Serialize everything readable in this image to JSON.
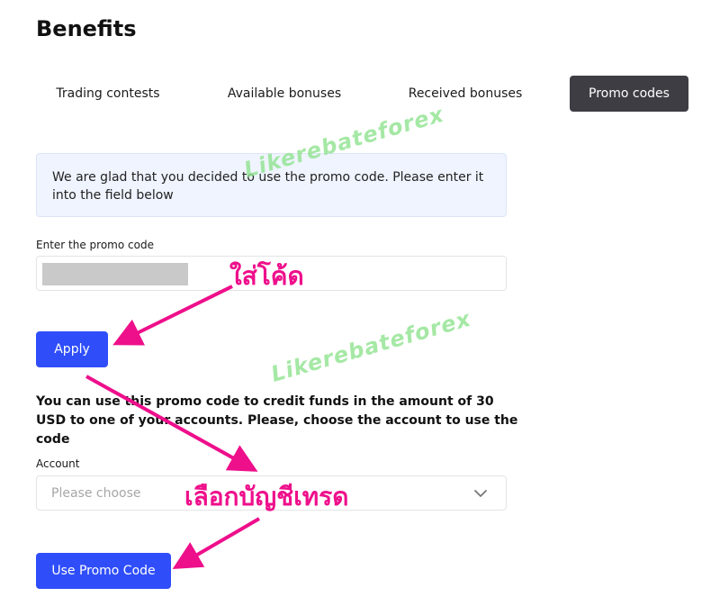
{
  "page": {
    "title": "Benefits"
  },
  "tabs": [
    {
      "label": "Trading contests"
    },
    {
      "label": "Available bonuses"
    },
    {
      "label": "Received bonuses"
    },
    {
      "label": "Promo codes",
      "active": true
    }
  ],
  "info_message": "We are glad that you decided to use the promo code. Please enter it into the field below",
  "promo_form": {
    "label": "Enter the promo code",
    "value": "",
    "apply_label": "Apply"
  },
  "credit_message": "You can use this promo code to credit funds in the amount of 30 USD to one of your accounts. Please, choose the account to use the code",
  "account_select": {
    "label": "Account",
    "placeholder": "Please choose",
    "icon": "chevron-down-icon"
  },
  "use_button_label": "Use Promo Code",
  "annotations": {
    "enter_code": "ใส่โค้ด",
    "choose_account": "เลือกบัญชีเทรด",
    "watermark": "Likerebateforex"
  },
  "colors": {
    "primary": "#2f4efa",
    "active_tab": "#3f3d44",
    "info_bg": "#eff4ff",
    "annotation": "#ee0f8b",
    "watermark": "#8fe38f"
  }
}
